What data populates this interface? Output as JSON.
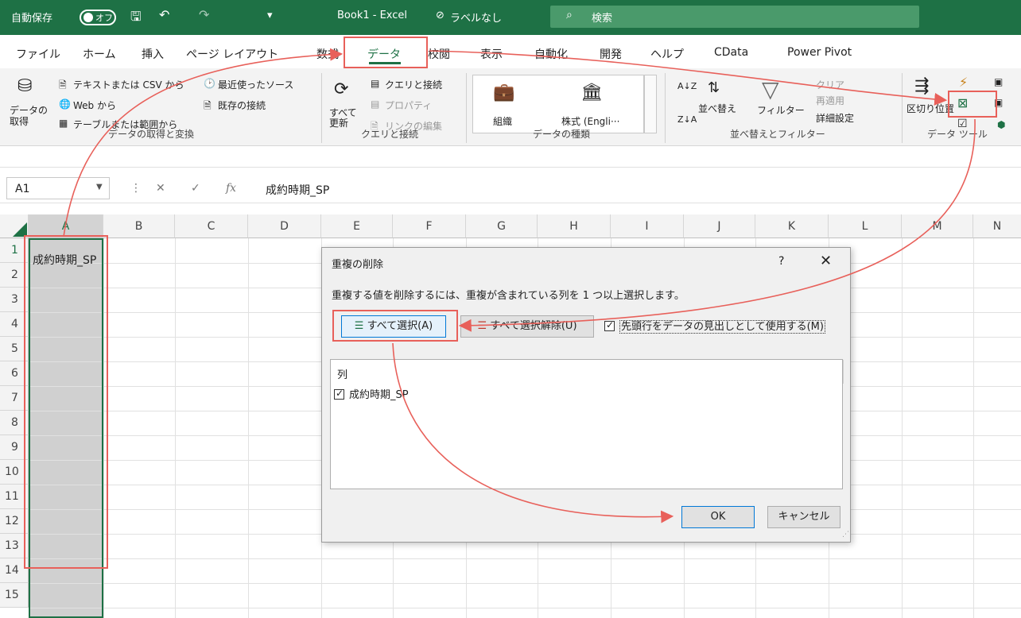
{
  "titlebar": {
    "autosave_label": "自動保存",
    "autosave_state": "オフ",
    "doc_title": "Book1 - Excel",
    "label_status": "ラベルなし",
    "search_placeholder": "検索"
  },
  "tabs": [
    "ファイル",
    "ホーム",
    "挿入",
    "ページ レイアウト",
    "数式",
    "データ",
    "校閲",
    "表示",
    "自動化",
    "開発",
    "ヘルプ",
    "CData",
    "Power Pivot"
  ],
  "active_tab": "データ",
  "ribbon": {
    "get_data": "データの\n取得",
    "text_csv": "テキストまたは CSV から",
    "web": "Web から",
    "table_range": "テーブルまたは範囲から",
    "recent_sources": "最近使ったソース",
    "existing_conn": "既存の接続",
    "group1": "データの取得と変換",
    "refresh_all": "すべて\n更新",
    "queries_conn": "クエリと接続",
    "properties": "プロパティ",
    "edit_links": "リンクの編集",
    "group2": "クエリと接続",
    "org": "組織",
    "stocks": "株式 (Engli···",
    "group3": "データの種類",
    "sort_az": "A↓Z",
    "sort": "並べ替え",
    "filter": "フィルター",
    "clear": "クリア",
    "reapply": "再適用",
    "advanced": "詳細設定",
    "group4": "並べ替えとフィルター",
    "text_to_cols": "区切り位置",
    "group5": "データ ツール"
  },
  "formula_bar": {
    "name_box": "A1",
    "fx": "fx",
    "content": "成約時期_SP"
  },
  "columns": [
    "A",
    "B",
    "C",
    "D",
    "E",
    "F",
    "G",
    "H",
    "I",
    "J",
    "K",
    "L",
    "M",
    "N"
  ],
  "rows": [
    "1",
    "2",
    "3",
    "4",
    "5",
    "6",
    "7",
    "8",
    "9",
    "10",
    "11",
    "12",
    "13",
    "14",
    "15"
  ],
  "cell_a1": "成約時期_SP",
  "dialog": {
    "title": "重複の削除",
    "help": "?",
    "close": "✕",
    "message": "重複する値を削除するには、重複が含まれている列を 1 つ以上選択します。",
    "select_all": "すべて選択(A)",
    "unselect_all": "すべて選択解除(U)",
    "header_checkbox": "先頭行をデータの見出しとして使用する(M)",
    "list_header": "列",
    "list_items": [
      "成約時期_SP"
    ],
    "ok": "OK",
    "cancel": "キャンセル"
  },
  "colors": {
    "excel_green": "#1e7145",
    "annotation_red": "#e8605a",
    "select_blue": "#0078d7"
  },
  "icons": [
    "save-icon",
    "undo-icon",
    "redo-icon",
    "search-icon",
    "close-icon",
    "help-icon",
    "checkbox-icon",
    "select-all-icon",
    "remove-duplicates-icon"
  ]
}
